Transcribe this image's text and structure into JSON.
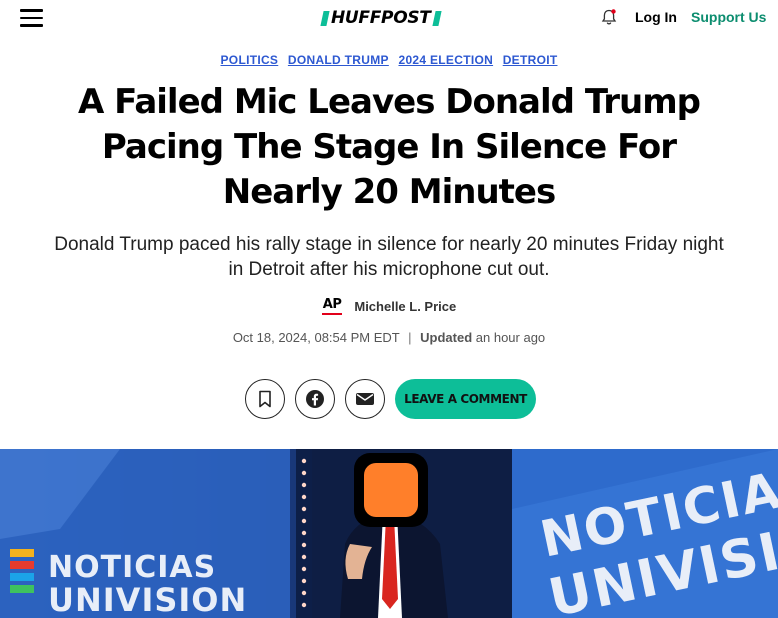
{
  "header": {
    "menu_icon": "hamburger-menu-icon",
    "logo_text": "HUFFPOST",
    "bell_icon": "bell-icon",
    "login_label": "Log In",
    "support_label": "Support Us"
  },
  "tags": [
    "POLITICS",
    "DONALD TRUMP",
    "2024 ELECTION",
    "DETROIT"
  ],
  "article": {
    "headline": "A Failed Mic Leaves Donald Trump Pacing The Stage In Silence For Nearly 20 Minutes",
    "subhead": "Donald Trump paced his rally stage in silence for nearly 20 minutes Friday night in Detroit after his microphone cut out.",
    "source_logo": "AP",
    "author": "Michelle L. Price",
    "date": "Oct 18, 2024, 08:54 PM EDT",
    "separator": "|",
    "updated_label": "Updated",
    "updated_value": "an hour ago"
  },
  "share": {
    "bookmark_icon": "bookmark-icon",
    "facebook_icon": "facebook-icon",
    "email_icon": "email-icon",
    "comment_label": "LEAVE A COMMENT"
  },
  "hero": {
    "left_sign_top": "NOTICIAS",
    "left_sign_bottom": "UNIVISION",
    "right_sign_top": "NOTICIA",
    "right_sign_bottom": "UNIVISI",
    "colors": {
      "background": "#1b3f8f",
      "accent": "#ff7f2a",
      "sign_white": "#e8eef8"
    }
  },
  "colors": {
    "brand_green": "#0dbe98",
    "support_green": "#0c8d6f",
    "tag_blue": "#2d58d1",
    "ap_red": "#e2001a"
  }
}
